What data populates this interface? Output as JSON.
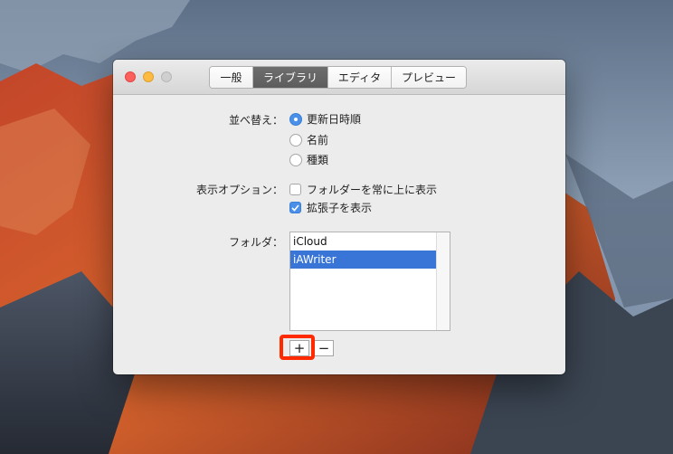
{
  "tabs": [
    {
      "label": "一般",
      "active": false
    },
    {
      "label": "ライブラリ",
      "active": true
    },
    {
      "label": "エディタ",
      "active": false
    },
    {
      "label": "プレビュー",
      "active": false
    }
  ],
  "sort": {
    "label": "並べ替え：",
    "options": [
      "更新日時順",
      "名前",
      "種類"
    ],
    "selected": "更新日時順"
  },
  "display": {
    "label": "表示オプション：",
    "options": [
      {
        "label": "フォルダーを常に上に表示",
        "checked": false
      },
      {
        "label": "拡張子を表示",
        "checked": true
      }
    ]
  },
  "folders": {
    "label": "フォルダ：",
    "items": [
      "iCloud",
      "iAWriter"
    ],
    "selected": "iAWriter"
  },
  "buttons": {
    "add": "+",
    "remove": "−"
  },
  "colors": {
    "accent": "#4a90e9",
    "selection": "#3875d7",
    "highlight": "#ff2a00"
  }
}
